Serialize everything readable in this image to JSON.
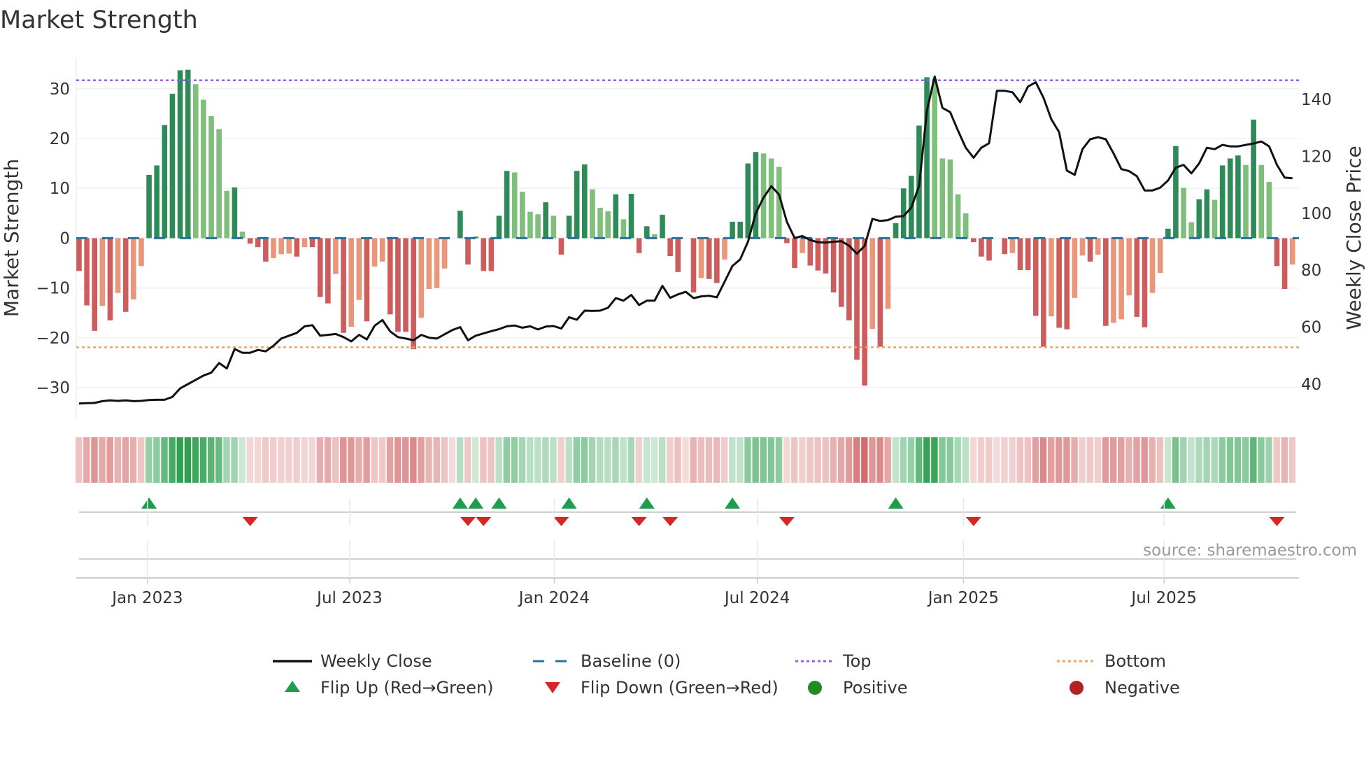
{
  "title": "Market Strength",
  "source": "source: sharemaestro.com",
  "colors": {
    "pos_strong": "#2e8b57",
    "pos_weak": "#7fbf7b",
    "neg_strong": "#cd5c5c",
    "neg_weak": "#e9967a",
    "price": "#111111",
    "baseline": "#2b6f9e",
    "top": "#9b5de5",
    "bottom": "#f4a261",
    "flip_up": "#1e9e4a",
    "flip_down": "#d62728",
    "positive": "#228b22",
    "negative": "#b22222",
    "heat_pos": "#2ea04f",
    "heat_neg": "#cd5c5c"
  },
  "legend": [
    {
      "key": "weekly_close",
      "label": "Weekly Close"
    },
    {
      "key": "baseline",
      "label": "Baseline (0)"
    },
    {
      "key": "top",
      "label": "Top"
    },
    {
      "key": "bottom",
      "label": "Bottom"
    },
    {
      "key": "flip_up",
      "label": "Flip Up (Red→Green)"
    },
    {
      "key": "flip_down",
      "label": "Flip Down (Green→Red)"
    },
    {
      "key": "positive",
      "label": "Positive"
    },
    {
      "key": "negative",
      "label": "Negative"
    }
  ],
  "chart_data": {
    "type": "bar",
    "title": "Market Strength",
    "ylabel": "Market Strength",
    "y2label": "Weekly Close Price",
    "ylim": [
      -36,
      36
    ],
    "y2lim": [
      33,
      156
    ],
    "yticks": [
      30,
      20,
      10,
      0,
      -10,
      -20,
      -30
    ],
    "ytick_labels": [
      "30",
      "20",
      "10",
      "0",
      "−10",
      "−20",
      "−30"
    ],
    "y2ticks": [
      140,
      120,
      100,
      80,
      60,
      40
    ],
    "y2tick_labels": [
      "140",
      "120",
      "100",
      "80",
      "60",
      "40"
    ],
    "xticks": [
      {
        "week": 8.8,
        "label": "Jan 2023"
      },
      {
        "week": 34.8,
        "label": "Jul 2023"
      },
      {
        "week": 61.1,
        "label": "Jan 2024"
      },
      {
        "week": 87.2,
        "label": "Jul 2024"
      },
      {
        "week": 113.7,
        "label": "Jan 2025"
      },
      {
        "week": 139.5,
        "label": "Jul 2025"
      }
    ],
    "top_level": 31.7,
    "bottom_level": -21.9,
    "baseline": 0,
    "strength": [
      -6.6,
      -13.5,
      -18.6,
      -13.6,
      -16.5,
      -11,
      -14.8,
      -12.3,
      -5.6,
      12.7,
      14.6,
      22.7,
      29,
      33.7,
      33.8,
      30.9,
      27.8,
      24.5,
      21.9,
      9.5,
      10.2,
      1.3,
      -1.1,
      -1.8,
      -4.7,
      -4,
      -3.2,
      -3.1,
      -3.7,
      -1.8,
      -1.8,
      -11.8,
      -13.1,
      -7.2,
      -19,
      -17.8,
      -12.4,
      -16.7,
      -5.7,
      -4.7,
      -15.3,
      -18.8,
      -18.8,
      -22.3,
      -16,
      -10.2,
      -10,
      -6.1,
      0,
      5.5,
      -5.3,
      0.3,
      -6.6,
      -6.6,
      4.5,
      13.5,
      13.2,
      9.3,
      5.3,
      4.8,
      7.2,
      4.5,
      -3.3,
      4.5,
      13.5,
      14.8,
      9.8,
      6.1,
      5.4,
      8.8,
      3.8,
      8.9,
      -3,
      2.4,
      0.8,
      4.7,
      -3.6,
      -6.8,
      0,
      -10.9,
      -8,
      -8.2,
      -9,
      -4.3,
      3.3,
      3.3,
      15,
      17.3,
      17,
      16,
      14.3,
      -1,
      -6,
      -3,
      -5.5,
      -6.5,
      -7.1,
      -10.9,
      -13.8,
      -16.5,
      -24.4,
      -29.6,
      -18.2,
      -21.8,
      -14.2,
      3,
      10,
      12.5,
      22.6,
      32.3,
      32,
      16,
      15.8,
      8.8,
      5,
      -0.8,
      -3.7,
      -4.5,
      0,
      -3.2,
      -3,
      -6.4,
      -6.4,
      -15.6,
      -21.8,
      -15.7,
      -18,
      -18.3,
      -12,
      -3.5,
      -4.7,
      -3.3,
      -17.6,
      -17,
      -16.3,
      -11.5,
      -15.8,
      -17.9,
      -11,
      -7,
      1.9,
      18.5,
      10.1,
      3.2,
      7.8,
      9.8,
      7.7,
      14.6,
      16,
      16.6,
      14.7,
      23.8,
      14.7,
      11.3,
      -5.6,
      -10.2,
      -5.3
    ],
    "weekly_close": [
      33.2,
      33.3,
      33.4,
      34,
      34.3,
      34.1,
      34.3,
      34,
      34.1,
      34.4,
      34.5,
      34.5,
      35.5,
      38.5,
      40,
      41.5,
      43,
      44,
      47.4,
      45.5,
      52.3,
      51,
      51,
      52,
      51.5,
      53.5,
      56,
      57,
      58,
      60.3,
      60.7,
      57,
      57.3,
      57.6,
      56.5,
      55,
      57.3,
      55.7,
      60.5,
      62.5,
      58.5,
      56.5,
      56,
      55.4,
      57.3,
      56.3,
      56,
      57.5,
      59,
      60,
      55.4,
      57,
      57.8,
      58.6,
      59.3,
      60.3,
      60.6,
      59.8,
      60.3,
      59.2,
      60.2,
      60.4,
      59.5,
      63.5,
      62.6,
      65.8,
      65.7,
      65.8,
      66.8,
      70.2,
      69.3,
      71.3,
      67.8,
      69.3,
      69.3,
      74.5,
      70.3,
      71.5,
      72.4,
      70.2,
      70.8,
      71,
      70.5,
      76,
      81.5,
      83.8,
      90,
      100,
      105.5,
      109.5,
      106.5,
      97,
      91.3,
      92,
      90.6,
      89.8,
      89.7,
      90,
      90.2,
      88.6,
      85.8,
      88.5,
      98,
      97.3,
      97.6,
      98.8,
      99,
      102,
      109.6,
      136,
      148,
      137,
      135.5,
      129,
      123,
      119.5,
      123,
      124.6,
      143,
      143,
      142.5,
      139,
      144.5,
      146,
      140.5,
      133,
      128.5,
      115,
      113.5,
      122.5,
      126,
      126.7,
      126,
      121,
      115.5,
      114.8,
      113,
      108,
      108,
      109,
      111.5,
      116,
      117,
      114,
      117.5,
      123,
      122.5,
      124,
      123.5,
      123.5,
      124,
      124.5,
      125.2,
      123.5,
      117,
      112.5,
      112.3
    ]
  }
}
